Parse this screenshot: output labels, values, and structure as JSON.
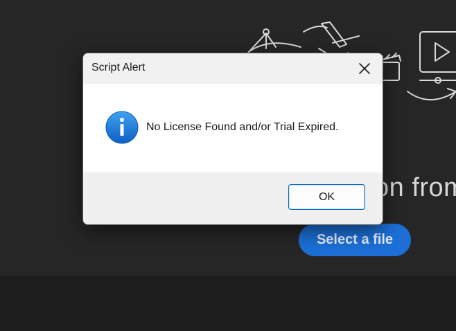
{
  "background": {
    "headline_partial": "on from",
    "select_button_label": "Select a file",
    "accent_color": "#1b6fd6"
  },
  "dialog": {
    "title": "Script Alert",
    "close_icon": "close-icon",
    "message": "No License Found and/or Trial Expired.",
    "icon": "info-icon",
    "ok_label": "OK",
    "icon_color": "#1a73d9"
  }
}
